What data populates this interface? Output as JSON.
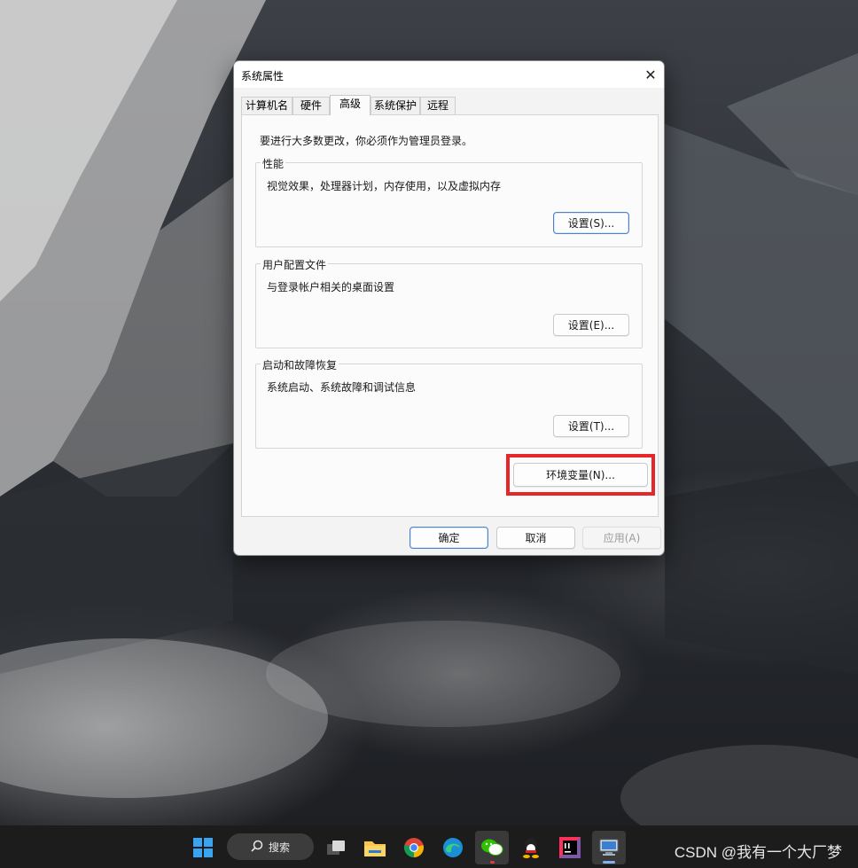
{
  "dialog": {
    "title": "系统属性",
    "close_glyph": "✕",
    "tabs": [
      {
        "label": "计算机名"
      },
      {
        "label": "硬件"
      },
      {
        "label": "高级"
      },
      {
        "label": "系统保护"
      },
      {
        "label": "远程"
      }
    ],
    "active_tab": "高级",
    "notice": "要进行大多数更改，你必须作为管理员登录。",
    "groups": {
      "performance": {
        "legend": "性能",
        "description": "视觉效果，处理器计划，内存使用，以及虚拟内存",
        "button": "设置(S)..."
      },
      "user_profiles": {
        "legend": "用户配置文件",
        "description": "与登录帐户相关的桌面设置",
        "button": "设置(E)..."
      },
      "startup_recovery": {
        "legend": "启动和故障恢复",
        "description": "系统启动、系统故障和调试信息",
        "button": "设置(T)..."
      }
    },
    "env_button": "环境变量(N)...",
    "highlight_color": "#e6272a",
    "footer": {
      "ok": "确定",
      "cancel": "取消",
      "apply": "应用(A)"
    }
  },
  "taskbar": {
    "search_label": "搜索",
    "icons": [
      "windows-start-icon",
      "search-icon",
      "task-view-icon",
      "file-explorer-icon",
      "chrome-icon",
      "edge-icon",
      "wechat-icon",
      "qq-icon",
      "intellij-icon",
      "system-properties-icon"
    ]
  },
  "watermark": "CSDN @我有一个大厂梦"
}
